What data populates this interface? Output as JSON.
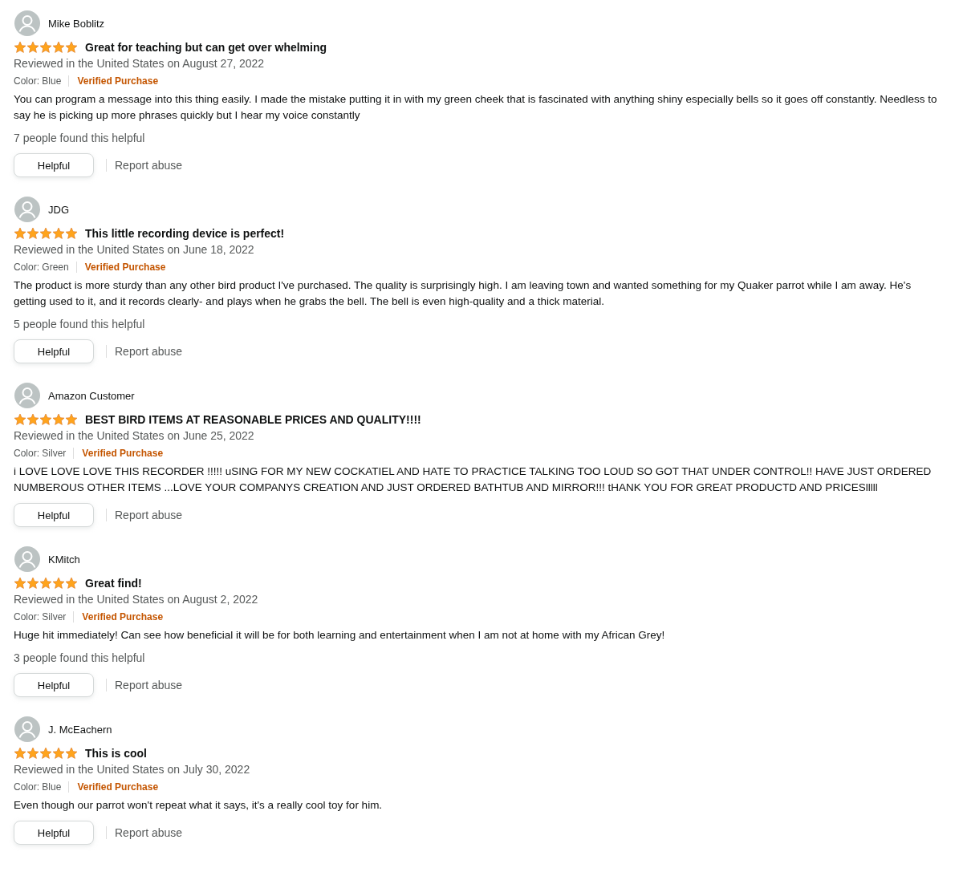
{
  "reviews": [
    {
      "author": "Mike Boblitz",
      "stars": 5,
      "title": "Great for teaching but can get over whelming",
      "date": "Reviewed in the United States on August 27, 2022",
      "variant": "Color: Blue",
      "badge": "Verified Purchase",
      "body": "You can program a message into this thing easily. I made the mistake putting it in with my green cheek that is fascinated with anything shiny especially bells so it goes off constantly. Needless to say he is picking up more phrases quickly but I hear my voice constantly",
      "helpful_count": "7 people found this helpful",
      "helpful_button": "Helpful",
      "report": "Report abuse"
    },
    {
      "author": "JDG",
      "stars": 5,
      "title": "This little recording device is perfect!",
      "date": "Reviewed in the United States on June 18, 2022",
      "variant": "Color: Green",
      "badge": "Verified Purchase",
      "body": "The product is more sturdy than any other bird product I've purchased. The quality is surprisingly high. I am leaving town and wanted something for my Quaker parrot while I am away. He's getting used to it, and it records clearly- and plays when he grabs the bell. The bell is even high-quality and a thick material.",
      "helpful_count": "5 people found this helpful",
      "helpful_button": "Helpful",
      "report": "Report abuse"
    },
    {
      "author": "Amazon Customer",
      "stars": 5,
      "title": "BEST BIRD ITEMS AT REASONABLE PRICES AND QUALITY!!!!",
      "date": "Reviewed in the United States on June 25, 2022",
      "variant": "Color: Silver",
      "badge": "Verified Purchase",
      "body": "i LOVE LOVE LOVE THIS RECORDER !!!!! uSING FOR MY NEW COCKATIEL AND HATE TO PRACTICE TALKING TOO LOUD SO GOT THAT UNDER CONTROL!! HAVE JUST ORDERED NUMBEROUS OTHER ITEMS ...LOVE YOUR COMPANYS CREATION AND JUST ORDERED BATHTUB AND MIRROR!!! tHANK YOU FOR GREAT PRODUCTD AND PRICESlllll",
      "helpful_button": "Helpful",
      "report": "Report abuse"
    },
    {
      "author": "KMitch",
      "stars": 5,
      "title": "Great find!",
      "date": "Reviewed in the United States on August 2, 2022",
      "variant": "Color: Silver",
      "badge": "Verified Purchase",
      "body": "Huge hit immediately! Can see how beneficial it will be for both learning and entertainment when I am not at home with my African Grey!",
      "helpful_count": "3 people found this helpful",
      "helpful_button": "Helpful",
      "report": "Report abuse"
    },
    {
      "author": "J. McEachern",
      "stars": 5,
      "title": "This is cool",
      "date": "Reviewed in the United States on July 30, 2022",
      "variant": "Color: Blue",
      "badge": "Verified Purchase",
      "body": "Even though our parrot won't repeat what it says, it's a really cool toy for him.",
      "helpful_button": "Helpful",
      "report": "Report abuse"
    }
  ]
}
